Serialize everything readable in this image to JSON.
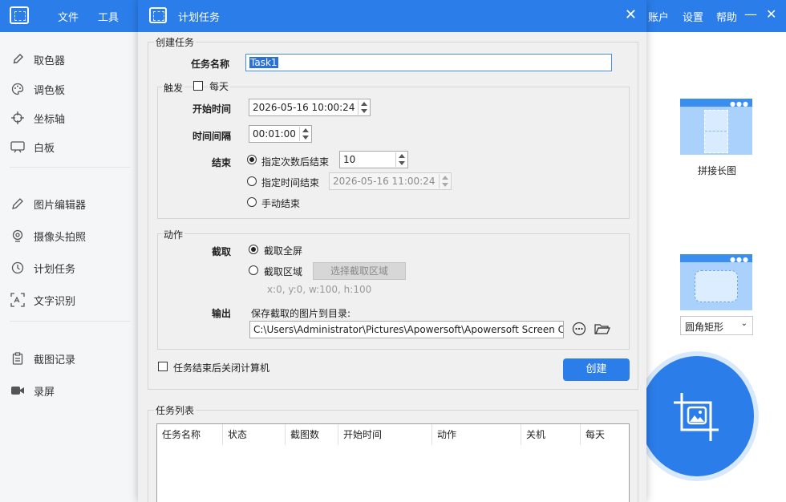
{
  "app": {
    "menu": [
      "文件",
      "工具"
    ],
    "menu_right": [
      "账户",
      "设置",
      "帮助"
    ],
    "sidebar": [
      {
        "label": "取色器",
        "icon": "eyedropper-icon"
      },
      {
        "label": "调色板",
        "icon": "palette-icon"
      },
      {
        "label": "坐标轴",
        "icon": "crosshair-icon"
      },
      {
        "label": "白板",
        "icon": "whiteboard-icon"
      },
      {
        "label": "图片编辑器",
        "icon": "pencil-icon"
      },
      {
        "label": "摄像头拍照",
        "icon": "webcam-icon"
      },
      {
        "label": "计划任务",
        "icon": "clock-icon"
      },
      {
        "label": "文字识别",
        "icon": "ocr-icon"
      },
      {
        "label": "截图记录",
        "icon": "clipboard-icon"
      },
      {
        "label": "录屏",
        "icon": "video-camera-icon"
      }
    ],
    "right": {
      "stitch_label": "拼接长图",
      "shape_select": "圆角矩形"
    },
    "accent": "#2b7de9"
  },
  "dialog": {
    "title": "计划任务",
    "create_group": "创建任务",
    "task_name_label": "任务名称",
    "task_name_value": "Task1",
    "trigger_group": "触发",
    "daily_label": "每天",
    "start_time_label": "开始时间",
    "start_time_value": "2026-05-16 10:00:24",
    "interval_label": "时间间隔",
    "interval_value": "00:01:00",
    "end_label": "结束",
    "end_after_count_label": "指定次数后结束",
    "end_count_value": "10",
    "end_at_time_label": "指定时间结束",
    "end_time_value": "2026-05-16 11:00:24",
    "end_manual_label": "手动结束",
    "action_group": "动作",
    "capture_label": "截取",
    "capture_fullscreen_label": "截取全屏",
    "capture_region_label": "截取区域",
    "select_region_button": "选择截取区域",
    "region_info": "x:0, y:0, w:100, h:100",
    "output_label": "输出",
    "save_dir_label": "保存截取的图片到目录:",
    "save_dir_value": "C:\\Users\\Administrator\\Pictures\\Apowersoft\\Apowersoft Screen Ca",
    "shutdown_label": "任务结束后关闭计算机",
    "create_button": "创建",
    "list_group": "任务列表",
    "columns": [
      "任务名称",
      "状态",
      "截图数",
      "开始时间",
      "动作",
      "关机",
      "每天"
    ]
  }
}
